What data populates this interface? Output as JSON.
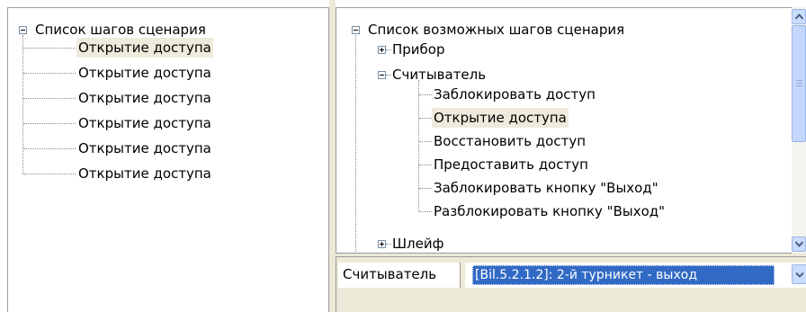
{
  "scenario_steps": {
    "root_label": "Список шагов сценария",
    "items": [
      "Открытие доступа",
      "Открытие доступа",
      "Открытие доступа",
      "Открытие доступа",
      "Открытие доступа",
      "Открытие доступа"
    ],
    "selected_index": 0
  },
  "available_steps": {
    "root_label": "Список возможных шагов сценария",
    "groups": [
      {
        "label": "Прибор",
        "expanded": false
      },
      {
        "label": "Считыватель",
        "expanded": true,
        "children": [
          "Заблокировать доступ",
          "Открытие доступа",
          "Восстановить доступ",
          "Предоставить доступ",
          "Заблокировать кнопку \"Выход\"",
          "Разблокировать кнопку \"Выход\""
        ],
        "selected_child_index": 1
      },
      {
        "label": "Шлейф",
        "expanded": false
      }
    ]
  },
  "property_row": {
    "label": "Считыватель",
    "value": "[Bil.5.2.1.2]: 2-й турникет - выход"
  },
  "icons": {
    "collapse": "minus-box-icon",
    "expand": "plus-box-icon",
    "scroll_up": "scroll-up-arrow-icon",
    "scroll_down": "scroll-down-arrow-icon",
    "dropdown": "chevron-down-icon"
  },
  "colors": {
    "selection_bg": "#316ac5",
    "tree_selection_bg": "#efebdc",
    "panel_border": "#9c9c9c",
    "scrollbar": "#c4d6fa"
  }
}
